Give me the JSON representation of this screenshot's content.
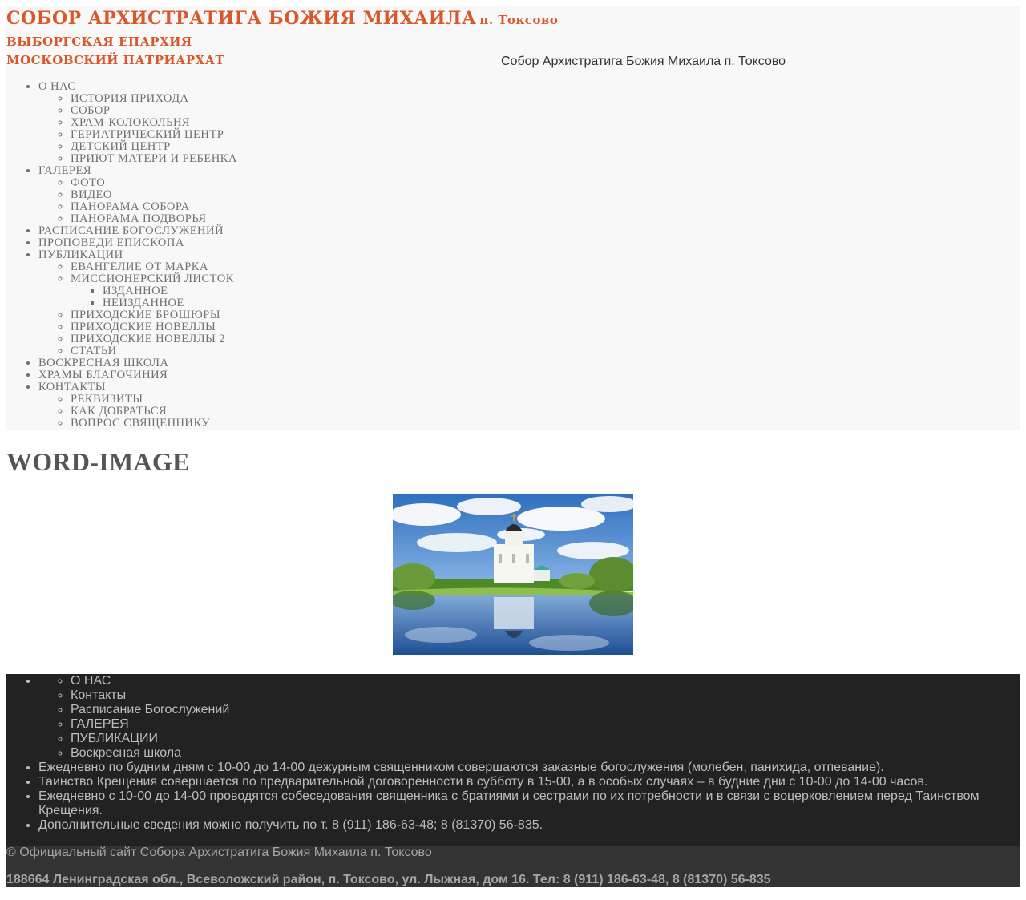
{
  "header": {
    "title": "Собор Архистратига Божия Михаила",
    "title_place": "п. Токсово",
    "subtitle1": "Выборгская епархия",
    "subtitle2": "Московский патриархат",
    "caption": "Собор Архистратига Божия Михаила п. Токсово"
  },
  "nav": {
    "about": "О НАС",
    "about_items": [
      "ИСТОРИЯ ПРИХОДА",
      "СОБОР",
      "ХРАМ-КОЛОКОЛЬНЯ",
      "ГЕРИАТРИЧЕСКИЙ ЦЕНТР",
      "ДЕТСКИЙ ЦЕНТР",
      "ПРИЮТ МАТЕРИ И РЕБЕНКА"
    ],
    "gallery": "ГАЛЕРЕЯ",
    "gallery_items": [
      "ФОТО",
      "ВИДЕО",
      "ПАНОРАМА СОБОРА",
      "ПАНОРАМА ПОДВОРЬЯ"
    ],
    "schedule": "РАСПИСАНИЕ БОГОСЛУЖЕНИЙ",
    "sermons": "ПРОПОВЕДИ ЕПИСКОПА",
    "publications": "ПУБЛИКАЦИИ",
    "gospel": "ЕВАНГЕЛИЕ ОТ МАРКА",
    "leaflet": "МИССИОНЕРСКИЙ ЛИСТОК",
    "leaflet_items": [
      "ИЗДАННОЕ",
      "НЕИЗДАННОЕ"
    ],
    "pub_items": [
      "ПРИХОДСКИЕ БРОШЮРЫ",
      "ПРИХОДСКИЕ НОВЕЛЛЫ",
      "ПРИХОДСКИЕ НОВЕЛЛЫ 2",
      "СТАТЬИ"
    ],
    "sunday_school": "ВОСКРЕСНАЯ ШКОЛА",
    "deanery": "ХРАМЫ БЛАГОЧИНИЯ",
    "contacts": "КОНТАКТЫ",
    "contacts_items": [
      "РЕКВИЗИТЫ",
      "КАК ДОБРАТЬСЯ",
      "ВОПРОС СВЯЩЕННИКУ"
    ]
  },
  "page": {
    "title": "WORD-IMAGE"
  },
  "footer": {
    "links": [
      "О НАС",
      "Контакты",
      "Расписание Богослужений",
      "ГАЛЕРЕЯ",
      "ПУБЛИКАЦИИ",
      "Воскресная школа"
    ],
    "info": [
      "Ежедневно по будним дням с 10-00 до 14-00 дежурным священником совершаются заказные богослужения (молебен, панихида, отпевание).",
      "Таинство Крещения совершается по предварительной договоренности в субботу в 15-00, а в особых случаях – в будние дни с 10-00 до 14-00 часов.",
      "Ежедневно с 10-00 до 14-00 проводятся собеседования священника с братиями и сестрами по их потребности и в связи с воцерковлением перед Таинством Крещения.",
      "Дополнительные сведения можно получить по т. 8 (911) 186-63-48; 8 (81370) 56-835."
    ]
  },
  "copyright": {
    "line1": "© Официальный сайт Собора Архистратига Божия Михаила п. Токсово",
    "line2": "188664 Ленинградская обл., Всеволожский район, п. Токсово, ул. Лыжная, дом 16. Тел: 8 (911) 186-63-48, 8 (81370) 56-835"
  },
  "colors": {
    "brand": "#d9582a",
    "header_bg": "#f8f8f8",
    "footer_bg": "#222222",
    "copyright_bg": "#333333"
  }
}
